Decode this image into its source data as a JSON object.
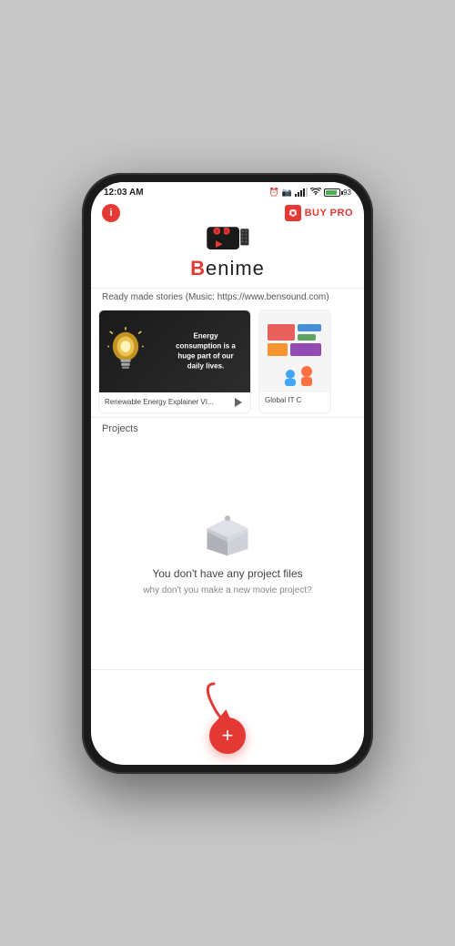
{
  "status_bar": {
    "time": "12:03 AM",
    "battery_percent": "93"
  },
  "header": {
    "info_label": "i",
    "buy_pro_label": "BUY PRO",
    "app_name_prefix": "B",
    "app_name_rest": "enime"
  },
  "stories": {
    "section_label": "Ready made stories (Music: https://www.bensound.com)",
    "cards": [
      {
        "title": "Renewable Energy Explainer VI...",
        "energy_text": "Energy\nconsumption is a\nhuge part of our\ndaily lives."
      },
      {
        "title": "Global IT C"
      }
    ]
  },
  "projects": {
    "label": "Projects",
    "empty_title": "You don't have any project files",
    "empty_subtitle": "why don't you make a new movie project?"
  },
  "fab": {
    "label": "+"
  }
}
